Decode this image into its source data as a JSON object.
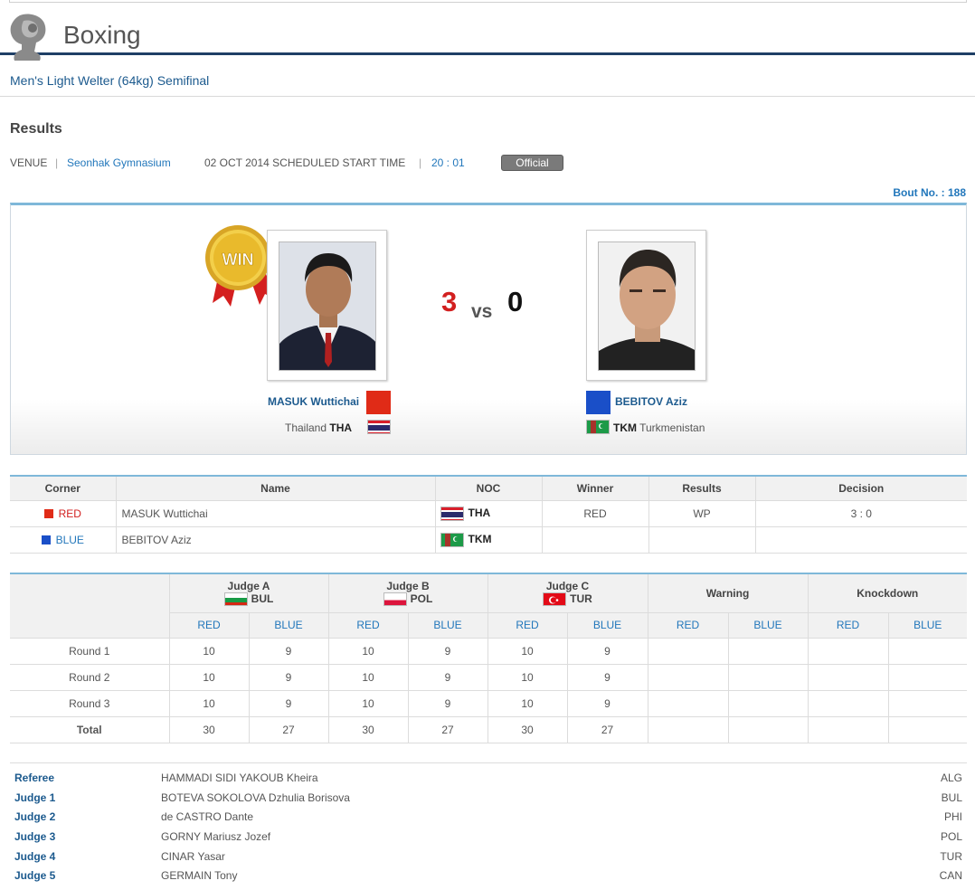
{
  "header": {
    "sport": "Boxing",
    "event": "Men's Light Welter (64kg) Semifinal"
  },
  "results": {
    "heading": "Results",
    "venue_label": "VENUE",
    "venue": "Seonhak Gymnasium",
    "date_label": "02 OCT 2014 SCHEDULED START TIME",
    "time": "20 : 01",
    "status": "Official",
    "bout": "Bout No. : 188"
  },
  "bout": {
    "win_badge": "WIN",
    "red_score": "3",
    "vs": "vs",
    "blue_score": "0",
    "red": {
      "name": "MASUK Wuttichai",
      "country": "Thailand",
      "noc": "THA",
      "color": "#e02b17"
    },
    "blue": {
      "name": "BEBITOV Aziz",
      "country": "Turkmenistan",
      "noc": "TKM",
      "color": "#1a4fc8"
    }
  },
  "summary": {
    "headers": [
      "Corner",
      "Name",
      "NOC",
      "Winner",
      "Results",
      "Decision"
    ],
    "rows": [
      {
        "corner": "RED",
        "name": "MASUK Wuttichai",
        "noc": "THA",
        "winner": "RED",
        "result": "WP",
        "decision": "3 : 0"
      },
      {
        "corner": "BLUE",
        "name": "BEBITOV Aziz",
        "noc": "TKM",
        "winner": "",
        "result": "",
        "decision": ""
      }
    ]
  },
  "scores": {
    "judges": [
      {
        "label": "Judge A",
        "noc": "BUL"
      },
      {
        "label": "Judge B",
        "noc": "POL"
      },
      {
        "label": "Judge C",
        "noc": "TUR"
      }
    ],
    "warning": "Warning",
    "knockdown": "Knockdown",
    "red": "RED",
    "blue": "BLUE",
    "rows": [
      {
        "label": "Round 1",
        "values": [
          "10",
          "9",
          "10",
          "9",
          "10",
          "9",
          "",
          "",
          "",
          ""
        ]
      },
      {
        "label": "Round 2",
        "values": [
          "10",
          "9",
          "10",
          "9",
          "10",
          "9",
          "",
          "",
          "",
          ""
        ]
      },
      {
        "label": "Round 3",
        "values": [
          "10",
          "9",
          "10",
          "9",
          "10",
          "9",
          "",
          "",
          "",
          ""
        ]
      },
      {
        "label": "Total",
        "values": [
          "30",
          "27",
          "30",
          "27",
          "30",
          "27",
          "",
          "",
          "",
          ""
        ]
      }
    ]
  },
  "officials": [
    {
      "role": "Referee",
      "name": "HAMMADI SIDI YAKOUB Kheira",
      "noc": "ALG"
    },
    {
      "role": "Judge 1",
      "name": "BOTEVA SOKOLOVA Dzhulia Borisova",
      "noc": "BUL"
    },
    {
      "role": "Judge 2",
      "name": "de CASTRO Dante",
      "noc": "PHI"
    },
    {
      "role": "Judge 3",
      "name": "GORNY Mariusz Jozef",
      "noc": "POL"
    },
    {
      "role": "Judge 4",
      "name": "CINAR Yasar",
      "noc": "TUR"
    },
    {
      "role": "Judge 5",
      "name": "GERMAIN Tony",
      "noc": "CAN"
    }
  ]
}
